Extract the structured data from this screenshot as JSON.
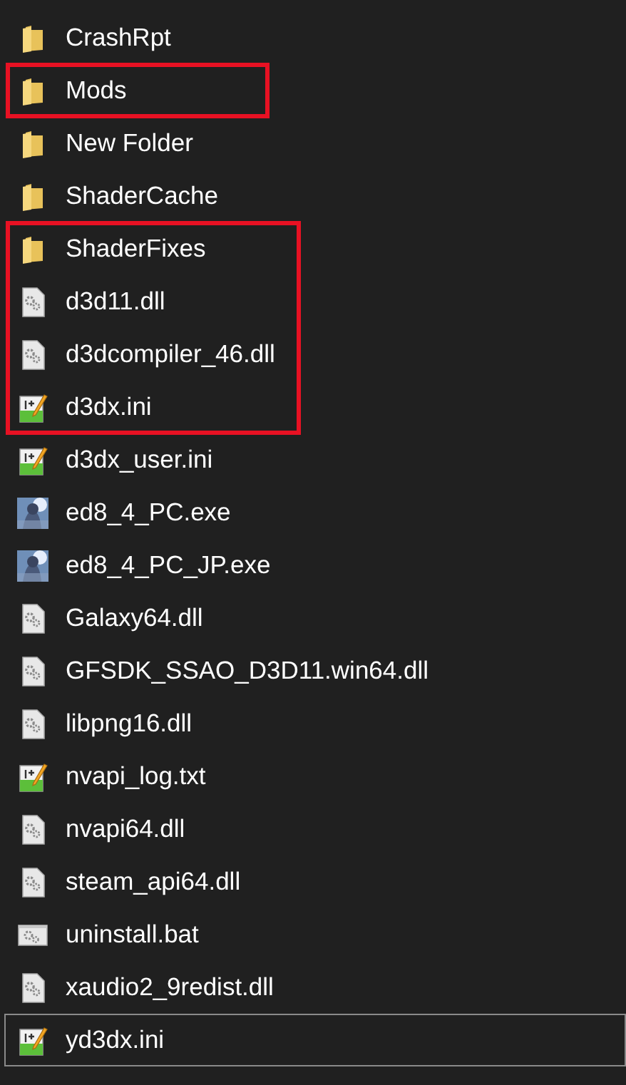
{
  "groups": [
    {
      "boxed": false,
      "items": [
        {
          "name": "CrashRpt",
          "kind": "folder",
          "focused": false
        }
      ]
    },
    {
      "boxed": true,
      "items": [
        {
          "name": "Mods",
          "kind": "folder",
          "focused": false
        }
      ]
    },
    {
      "boxed": false,
      "items": [
        {
          "name": "New Folder",
          "kind": "folder",
          "focused": false
        },
        {
          "name": "ShaderCache",
          "kind": "folder",
          "focused": false
        }
      ]
    },
    {
      "boxed": true,
      "items": [
        {
          "name": "ShaderFixes",
          "kind": "folder",
          "focused": false
        },
        {
          "name": "d3d11.dll",
          "kind": "dll",
          "focused": false
        },
        {
          "name": "d3dcompiler_46.dll",
          "kind": "dll",
          "focused": false
        },
        {
          "name": "d3dx.ini",
          "kind": "ini",
          "focused": false
        }
      ]
    },
    {
      "boxed": false,
      "items": [
        {
          "name": "d3dx_user.ini",
          "kind": "ini",
          "focused": false
        },
        {
          "name": "ed8_4_PC.exe",
          "kind": "exe",
          "focused": false
        },
        {
          "name": "ed8_4_PC_JP.exe",
          "kind": "exe",
          "focused": false
        },
        {
          "name": "Galaxy64.dll",
          "kind": "dll",
          "focused": false
        },
        {
          "name": "GFSDK_SSAO_D3D11.win64.dll",
          "kind": "dll",
          "focused": false
        },
        {
          "name": "libpng16.dll",
          "kind": "dll",
          "focused": false
        },
        {
          "name": "nvapi_log.txt",
          "kind": "ini",
          "focused": false
        },
        {
          "name": "nvapi64.dll",
          "kind": "dll",
          "focused": false
        },
        {
          "name": "steam_api64.dll",
          "kind": "dll",
          "focused": false
        },
        {
          "name": "uninstall.bat",
          "kind": "bat",
          "focused": false
        },
        {
          "name": "xaudio2_9redist.dll",
          "kind": "dll",
          "focused": false
        },
        {
          "name": "yd3dx.ini",
          "kind": "ini",
          "focused": true
        }
      ]
    }
  ]
}
